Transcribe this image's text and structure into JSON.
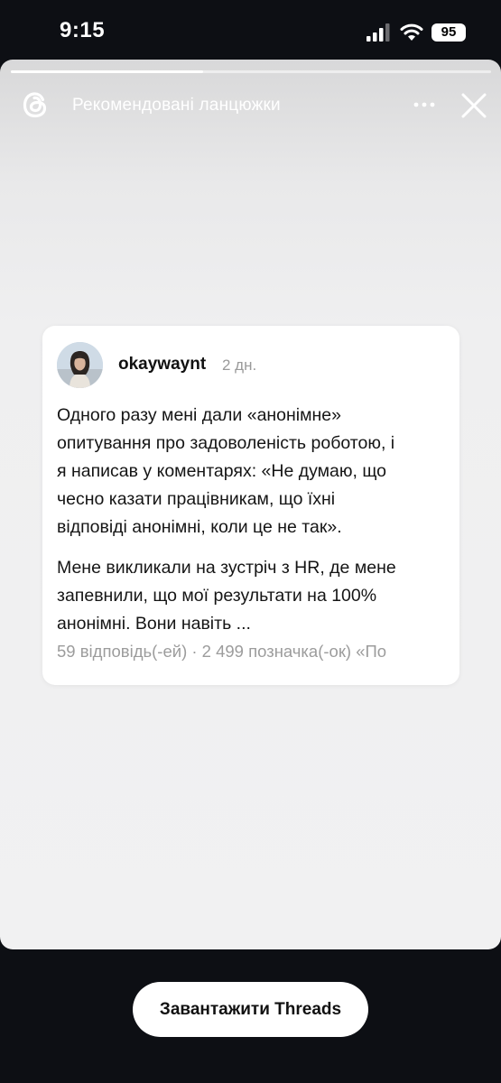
{
  "status_bar": {
    "time": "9:15",
    "battery": "95",
    "signal_icon": "cellular-signal-icon",
    "wifi_icon": "wifi-icon"
  },
  "story": {
    "title": "Рекомендовані ланцюжки",
    "progress": 0.4,
    "logo_icon": "threads-logo-icon",
    "more_icon": "more-dots-icon",
    "close_icon": "close-icon"
  },
  "post": {
    "username": "okaywaynt",
    "time": "2 дн.",
    "paragraphs": [
      "Одного разу мені дали «анонімне»\nопитування про задоволеність роботою, і\nя написав у коментарях: «Не думаю, що\nчесно казати працівникам, що їхні\nвідповіді анонімні, коли це не так».",
      "Мене викликали на зустріч з HR, де мене\nзапевнили, що мої результати на 100%\nанонімні. Вони навіть ..."
    ],
    "stats": "59 відповідь(-ей) · 2 499 позначка(-ок) «По"
  },
  "footer": {
    "download_label": "Завантажити Threads"
  },
  "colors": {
    "background": "#0d0f14",
    "story_bg": "#f1f1f2",
    "card_bg": "#ffffff",
    "muted_text": "#9c9c9c"
  }
}
